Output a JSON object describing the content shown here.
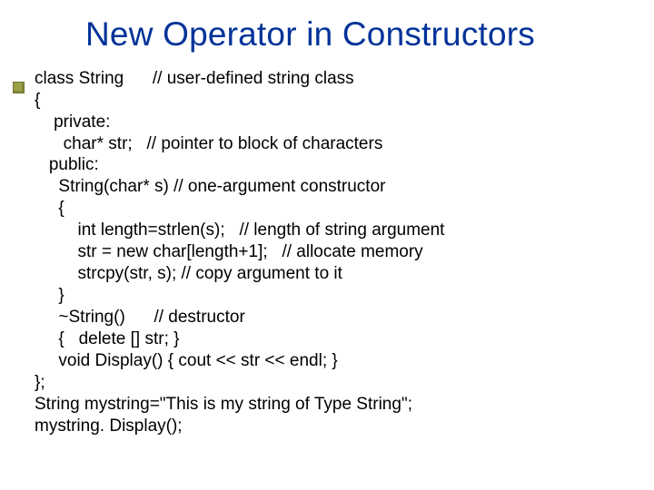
{
  "title": "New Operator in Constructors",
  "code": {
    "l01": "class String      // user-defined string class",
    "l02": "{",
    "l03": "    private:",
    "l04": "      char* str;   // pointer to block of characters",
    "l05": "   public:",
    "l06": "     String(char* s) // one-argument constructor",
    "l07": "     {",
    "l08": "         int length=strlen(s);   // length of string argument",
    "l09": "         str = new char[length+1];   // allocate memory",
    "l10": "         strcpy(str, s); // copy argument to it",
    "l11": "     }",
    "l12": "     ~String()      // destructor",
    "l13": "     {   delete [] str; }",
    "l14": "     void Display() { cout << str << endl; }",
    "l15": "};",
    "l16": "String mystring=\"This is my string of Type String\";",
    "l17": "mystring. Display();"
  }
}
